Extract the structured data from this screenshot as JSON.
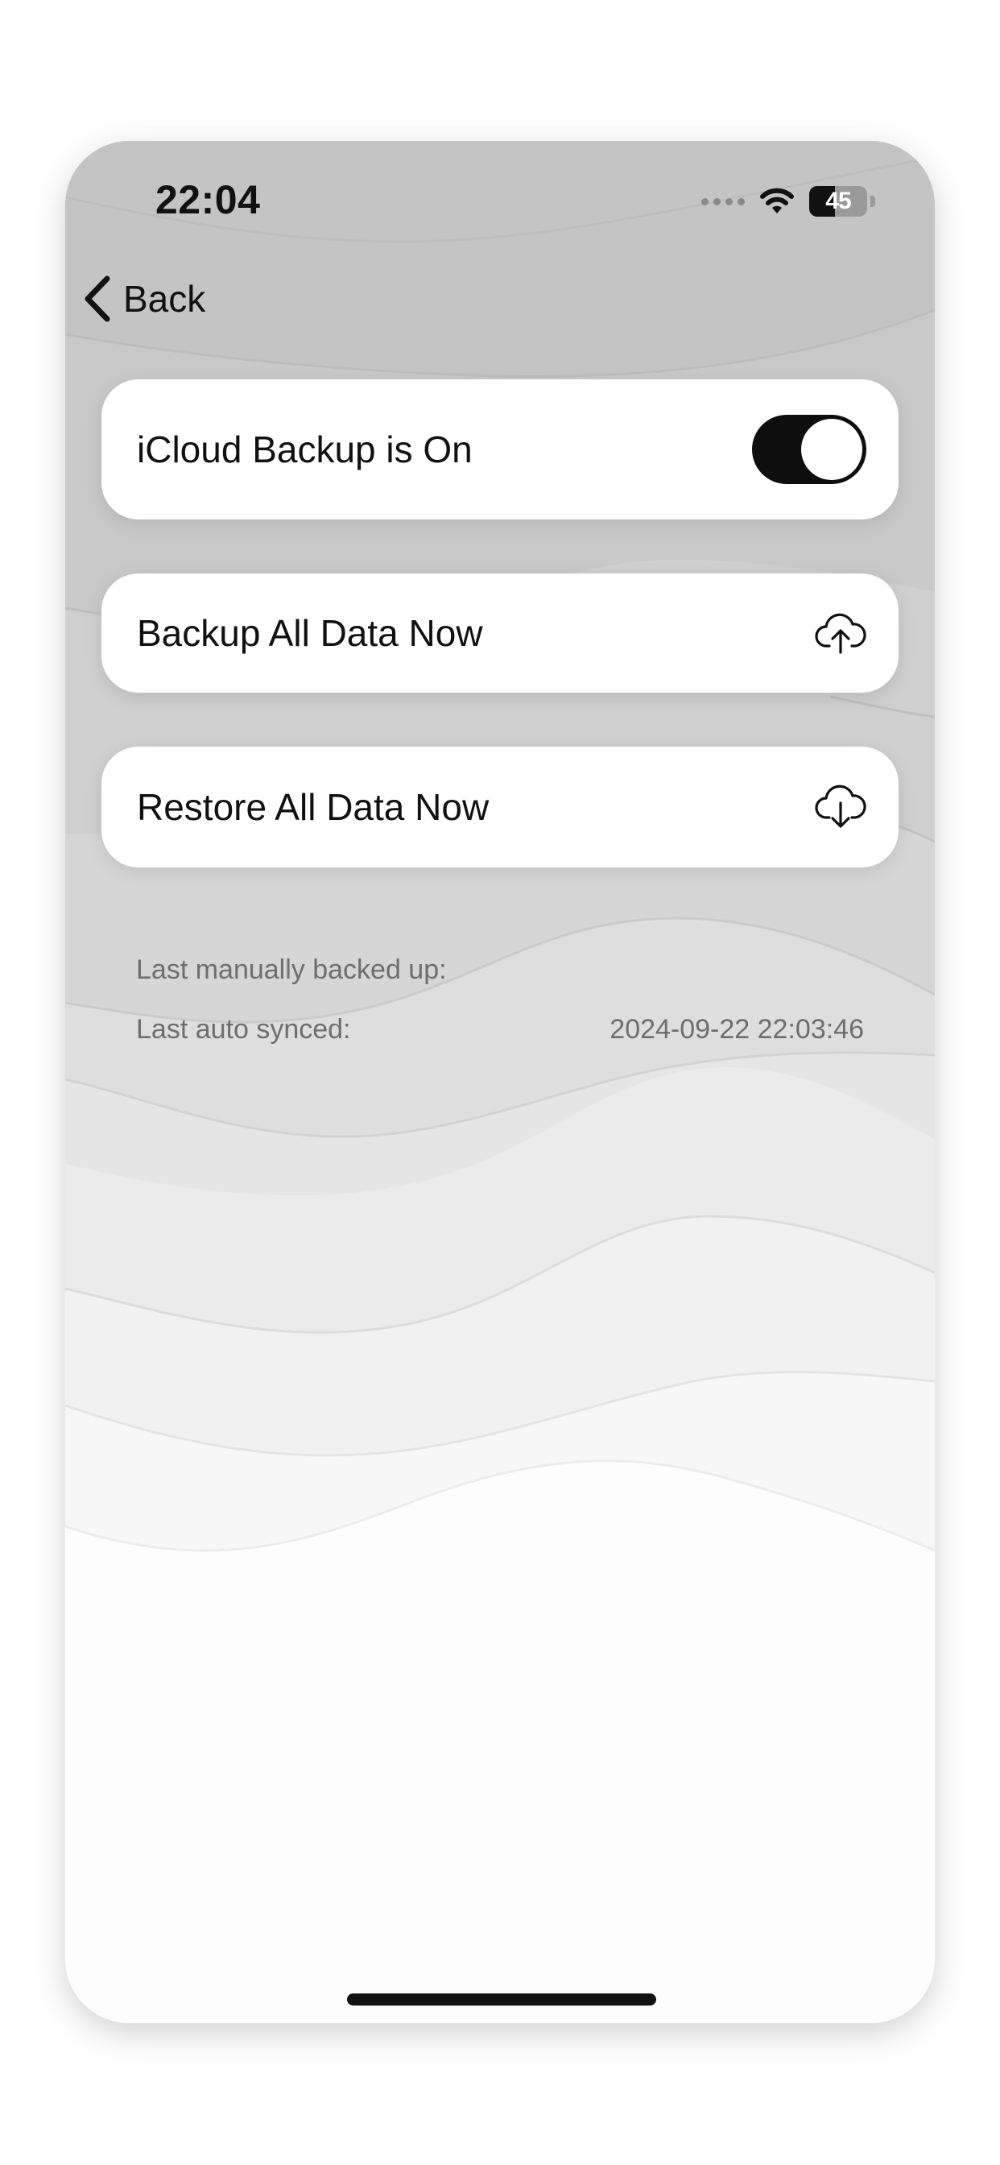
{
  "status_bar": {
    "time": "22:04",
    "battery": "45",
    "battery_level": 0.45
  },
  "nav": {
    "back_label": "Back"
  },
  "settings": {
    "icloud_backup_label": "iCloud Backup is On",
    "icloud_backup_enabled": true,
    "backup_label": "Backup All Data Now",
    "backup_icon": "cloud-upload-icon",
    "restore_label": "Restore All Data Now",
    "restore_icon": "cloud-download-icon"
  },
  "info": {
    "last_manual_label": "Last manually backed up:",
    "last_manual_value": "",
    "last_auto_label": "Last auto synced:",
    "last_auto_value": "2024-09-22 22:03:46"
  },
  "colors": {
    "background_top": "#c4c4c4",
    "card": "#ffffff",
    "toggle_on": "#0e0e0e",
    "text": "#111111",
    "secondary_text": "#6e6e6e"
  }
}
